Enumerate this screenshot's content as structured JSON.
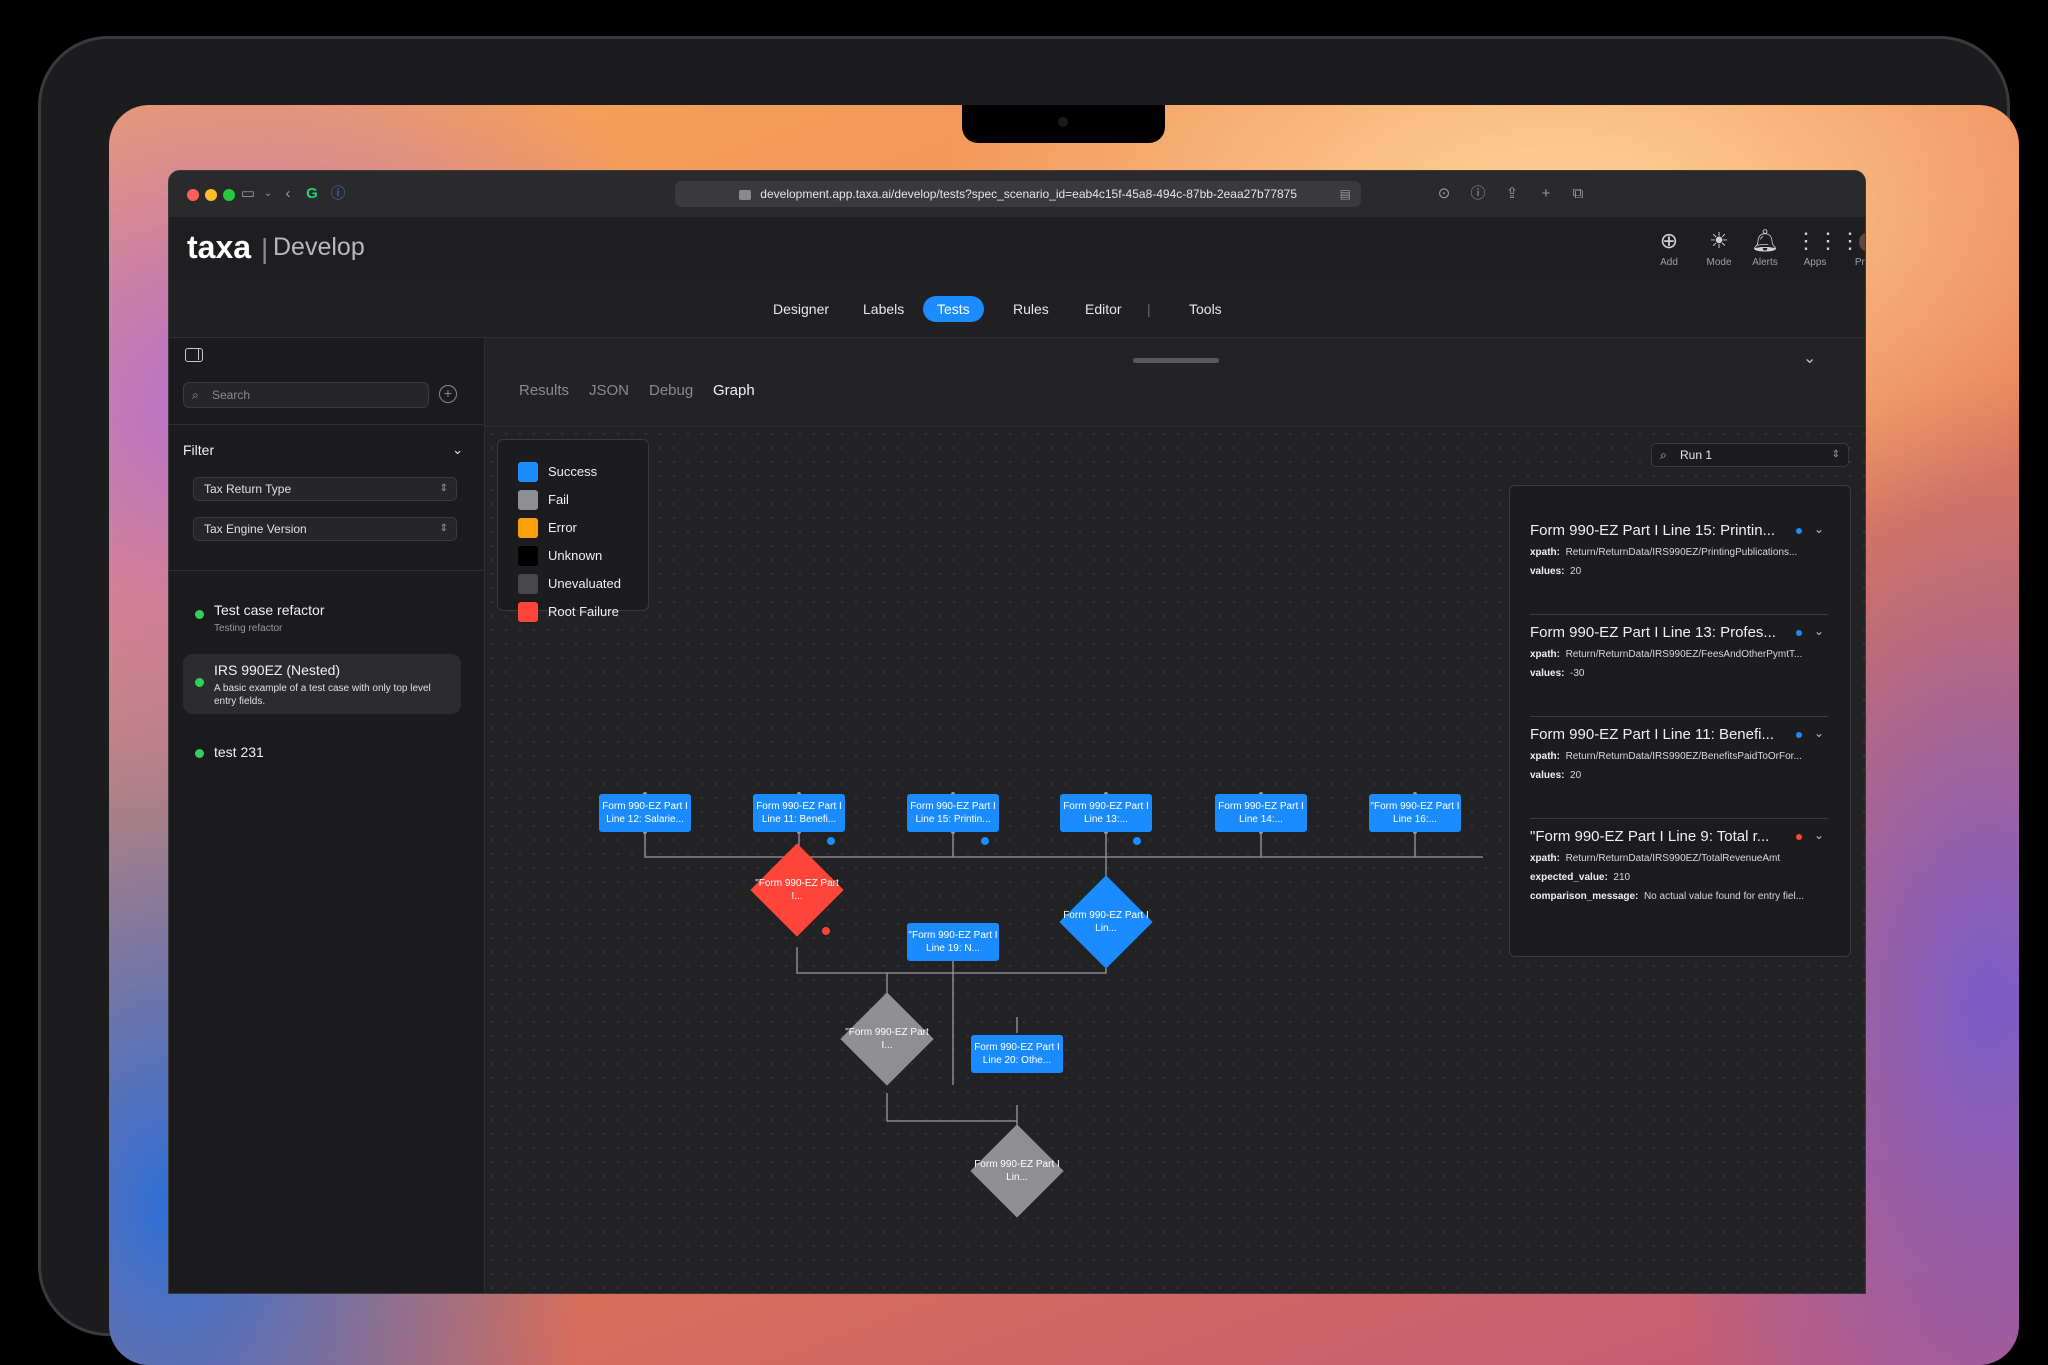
{
  "browser": {
    "url": "development.app.taxa.ai/develop/tests?spec_scenario_id=eab4c15f-45a8-494c-87bb-2eaa27b77875"
  },
  "app": {
    "logo": "taxa",
    "separator": "|",
    "section": "Develop",
    "header_actions": [
      {
        "label": "Add",
        "icon": "plus-circle-icon"
      },
      {
        "label": "Mode",
        "icon": "sun-icon"
      },
      {
        "label": "Alerts",
        "icon": "bell-icon"
      },
      {
        "label": "Apps",
        "icon": "grid-icon"
      },
      {
        "label": "Profile",
        "icon": "avatar-icon"
      }
    ]
  },
  "nav": {
    "items": [
      "Designer",
      "Labels",
      "Tests",
      "Rules",
      "Editor",
      "|",
      "Tools"
    ],
    "active": "Tests"
  },
  "sidebar": {
    "search_placeholder": "Search",
    "filter_label": "Filter",
    "selects": [
      "Tax Return Type",
      "Tax Engine Version"
    ],
    "cases": [
      {
        "title": "Test case refactor",
        "desc": "Testing refactor",
        "status_color": "#30d158"
      },
      {
        "title": "IRS 990EZ (Nested)",
        "desc": "A basic example of a test case with only top level entry fields.",
        "status_color": "#30d158",
        "selected": true
      },
      {
        "title": "test 231",
        "desc": "",
        "status_color": "#30d158"
      }
    ]
  },
  "main": {
    "tabs": [
      "Results",
      "JSON",
      "Debug",
      "Graph"
    ],
    "active_tab": "Graph",
    "run_select": "Run 1",
    "legend": [
      {
        "label": "Success",
        "color": "#1a8cff"
      },
      {
        "label": "Fail",
        "color": "#8e8e93"
      },
      {
        "label": "Error",
        "color": "#ff9f0a"
      },
      {
        "label": "Unknown",
        "color": "#000000"
      },
      {
        "label": "Unevaluated",
        "color": "#48484a"
      },
      {
        "label": "Root Failure",
        "color": "#ff453a"
      }
    ],
    "panel_items": [
      {
        "title": "Form 990-EZ Part I Line 15: Printin...",
        "dot": "#1a8cff",
        "rows": [
          {
            "k": "xpath:",
            "v": "Return/ReturnData/IRS990EZ/PrintingPublications..."
          },
          {
            "k": "values:",
            "v": "20"
          }
        ]
      },
      {
        "title": "Form 990-EZ Part I Line 13: Profes...",
        "dot": "#1a8cff",
        "rows": [
          {
            "k": "xpath:",
            "v": "Return/ReturnData/IRS990EZ/FeesAndOtherPymtT..."
          },
          {
            "k": "values:",
            "v": "-30"
          }
        ]
      },
      {
        "title": "Form 990-EZ Part I Line 11: Benefi...",
        "dot": "#1a8cff",
        "rows": [
          {
            "k": "xpath:",
            "v": "Return/ReturnData/IRS990EZ/BenefitsPaidToOrFor..."
          },
          {
            "k": "values:",
            "v": "20"
          }
        ]
      },
      {
        "title": "\"Form 990-EZ Part I Line 9: Total r...",
        "dot": "#ff453a",
        "rows": [
          {
            "k": "xpath:",
            "v": "Return/ReturnData/IRS990EZ/TotalRevenueAmt"
          },
          {
            "k": "expected_value:",
            "v": "210"
          },
          {
            "k": "comparison_message:",
            "v": "No actual value found for entry fiel..."
          }
        ]
      }
    ],
    "graph_nodes": [
      {
        "text": "Form 990-EZ Part I Line 12: Salarie...",
        "shape": "box",
        "status": "success"
      },
      {
        "text": "Form 990-EZ Part I Line 11: Benefi...",
        "shape": "box",
        "status": "success"
      },
      {
        "text": "Form 990-EZ Part I Line 15: Printin...",
        "shape": "box",
        "status": "success"
      },
      {
        "text": "Form 990-EZ Part I Line 13:...",
        "shape": "box",
        "status": "success"
      },
      {
        "text": "Form 990-EZ Part I Line 14:...",
        "shape": "box",
        "status": "success"
      },
      {
        "text": "\"Form 990-EZ Part I Line 16:...",
        "shape": "box",
        "status": "success"
      },
      {
        "text": "\"Form 990-EZ Part I...",
        "shape": "diamond",
        "status": "root-failure"
      },
      {
        "text": "\"Form 990-EZ Part I Line 19: N...",
        "shape": "box",
        "status": "success"
      },
      {
        "text": "Form 990-EZ Part I Lin...",
        "shape": "diamond",
        "status": "success"
      },
      {
        "text": "\"Form 990-EZ Part I...",
        "shape": "diamond",
        "status": "fail"
      },
      {
        "text": "Form 990-EZ Part I Line 20: Othe...",
        "shape": "box",
        "status": "success"
      },
      {
        "text": "Form 990-EZ Part I Lin...",
        "shape": "diamond",
        "status": "fail"
      }
    ]
  }
}
